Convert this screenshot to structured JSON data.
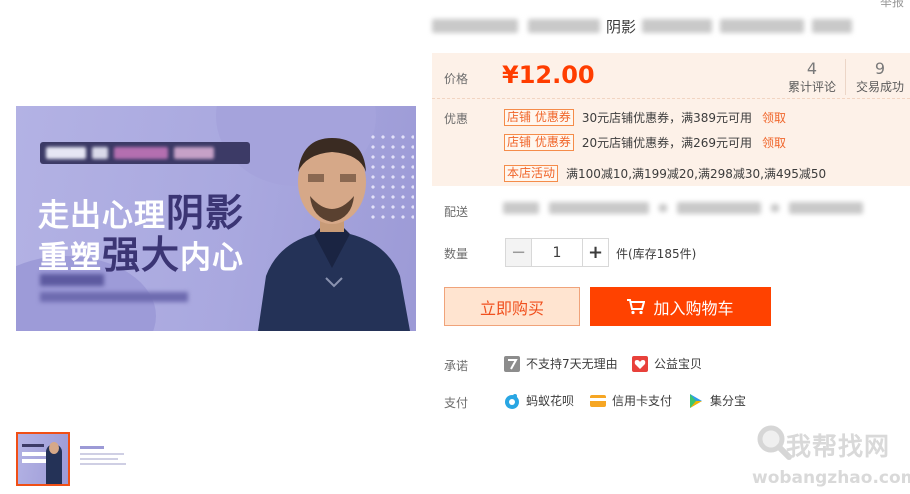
{
  "header": {
    "corner_text": "举报"
  },
  "title": {
    "keyword": "阴影"
  },
  "hero": {
    "line1_a": "走出心理",
    "line1_b": "阴影",
    "line2_a": "重塑",
    "line2_b": "强大",
    "line2_c": "内心"
  },
  "price": {
    "label": "价格",
    "value": "¥12.00",
    "reviews_count": "4",
    "reviews_label": "累计评论",
    "sales_count": "9",
    "sales_label": "交易成功"
  },
  "promo": {
    "label": "优惠",
    "coupons": [
      {
        "tag": "店铺 优惠券",
        "desc": "30元店铺优惠券，满389元可用",
        "link": "领取"
      },
      {
        "tag": "店铺 优惠券",
        "desc": "20元店铺优惠券，满269元可用",
        "link": "领取"
      }
    ],
    "activity_tag": "本店活动",
    "activity_desc": "满100减10,满199减20,满298减30,满495减50"
  },
  "shipping": {
    "label": "配送"
  },
  "quantity": {
    "label": "数量",
    "value": "1",
    "minus": "−",
    "plus": "+",
    "stock": "件(库存185件)"
  },
  "actions": {
    "buy_now": "立即购买",
    "add_cart": "加入购物车"
  },
  "promise": {
    "label": "承诺",
    "items": [
      "不支持7天无理由",
      "公益宝贝"
    ]
  },
  "payment": {
    "label": "支付",
    "items": [
      "蚂蚁花呗",
      "信用卡支付",
      "集分宝"
    ]
  },
  "watermark": {
    "title": "我帮找网",
    "url": "wobangzhao.com"
  },
  "colors": {
    "accent": "#ff4200",
    "price": "#ff3d00",
    "panel_bg": "#fdf1e8"
  }
}
